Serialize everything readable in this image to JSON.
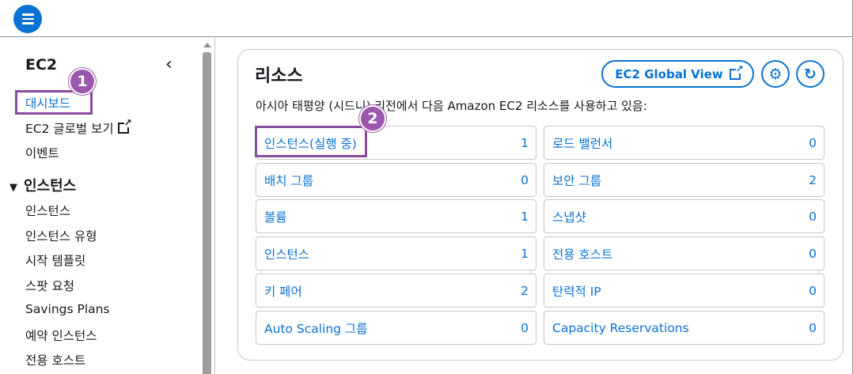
{
  "sidebar": {
    "title": "EC2",
    "links": {
      "dashboard": "대시보드",
      "global_view": "EC2 글로벌 보기",
      "events": "이벤트"
    },
    "section_title": "인스턴스",
    "section_items": [
      "인스턴스",
      "인스턴스 유형",
      "시작 템플릿",
      "스팟 요청",
      "Savings Plans",
      "예약 인스턴스",
      "전용 호스트"
    ]
  },
  "markers": [
    "1",
    "2"
  ],
  "resources": {
    "title": "리소스",
    "description": "아시아 태평양 (시드니) 리전에서 다음 Amazon EC2 리소스를 사용하고 있음:",
    "global_view_label": "EC2 Global View",
    "items": [
      {
        "label": "인스턴스(실행 중)",
        "count": "1"
      },
      {
        "label": "로드 밸런서",
        "count": "0"
      },
      {
        "label": "배치 그룹",
        "count": "0"
      },
      {
        "label": "보안 그룹",
        "count": "2"
      },
      {
        "label": "볼륨",
        "count": "1"
      },
      {
        "label": "스냅샷",
        "count": "0"
      },
      {
        "label": "인스턴스",
        "count": "1"
      },
      {
        "label": "전용 호스트",
        "count": "0"
      },
      {
        "label": "키 페어",
        "count": "2"
      },
      {
        "label": "탄력적 IP",
        "count": "0"
      },
      {
        "label": "Auto Scaling 그룹",
        "count": "0"
      },
      {
        "label": "Capacity Reservations",
        "count": "0"
      }
    ]
  },
  "colors": {
    "accent": "#0972d3",
    "marker": "#9b57ad"
  }
}
